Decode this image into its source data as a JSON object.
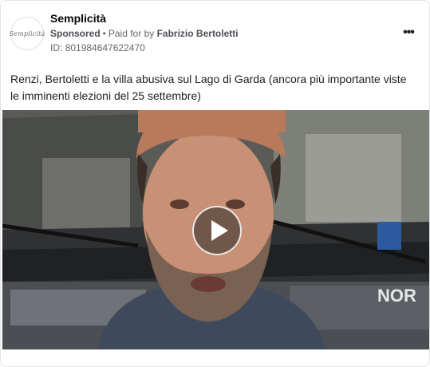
{
  "post": {
    "page_name": "Semplicità",
    "avatar_text": "Semplicità",
    "sponsored_label": "Sponsored",
    "separator": "•",
    "paid_for_prefix": "Paid for by",
    "paid_for_name": "Fabrizio Bertoletti",
    "ad_id": "ID: 801984647622470",
    "more_label": "•••",
    "body_text": "Renzi, Bertoletti e la villa abusiva sul Lago di Garda (ancora più importante viste le imminenti elezioni del 25 settembre)"
  },
  "video": {
    "thumbnail_description_icon": "play-icon",
    "truck_text": "NOR",
    "colors": {
      "cap": "#b87a5a",
      "skin": "#c89074",
      "shirt": "#3e4a5c",
      "truck": "#3a3d40"
    }
  }
}
